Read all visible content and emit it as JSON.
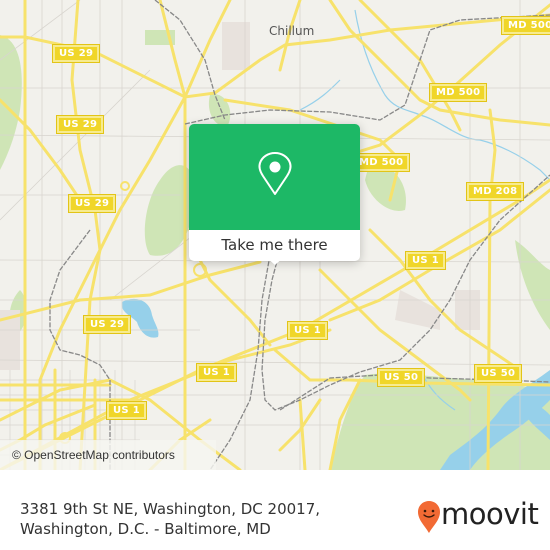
{
  "map": {
    "place_labels": [
      {
        "id": "chillum",
        "text": "Chillum"
      }
    ],
    "shields": [
      {
        "text": "US 29"
      },
      {
        "text": "US 29"
      },
      {
        "text": "US 29"
      },
      {
        "text": "US 29"
      },
      {
        "text": "US 1"
      },
      {
        "text": "US 1"
      },
      {
        "text": "US 1"
      },
      {
        "text": "US 1"
      },
      {
        "text": "US 50"
      },
      {
        "text": "US 50"
      },
      {
        "text": "MD 500"
      },
      {
        "text": "MD 500"
      },
      {
        "text": "MD 500"
      },
      {
        "text": "MD 208"
      }
    ],
    "attribution": "© OpenStreetMap contributors",
    "colors": {
      "background": "#f2f1ec",
      "road": "#f7e26b",
      "water": "#8fd0ea",
      "park": "#c9e2ad",
      "rail": "#7a7a7a"
    }
  },
  "popup": {
    "button_label": "Take me there",
    "icon": "location-pin-icon",
    "color": "#1db866"
  },
  "footer": {
    "address": "3381 9th St NE, Washington, DC 20017, Washington, D.C. - Baltimore, MD",
    "brand": "moovit",
    "brand_color": "#f26a34"
  }
}
